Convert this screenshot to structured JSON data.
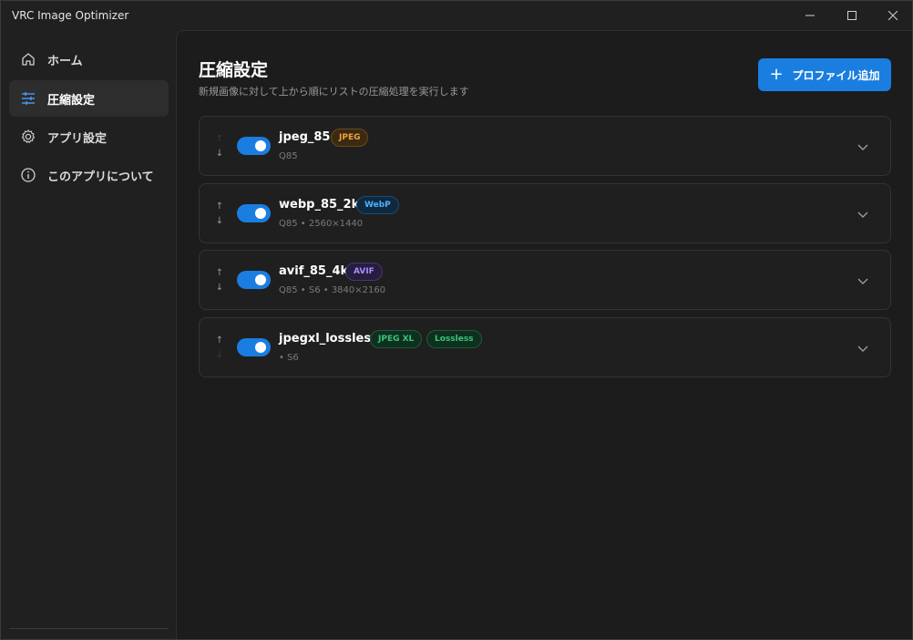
{
  "app": {
    "title": "VRC Image Optimizer"
  },
  "sidebar": {
    "items": [
      {
        "label": "ホーム",
        "icon": "home-icon"
      },
      {
        "label": "圧縮設定",
        "icon": "sliders-icon",
        "active": true
      },
      {
        "label": "アプリ設定",
        "icon": "gear-icon"
      },
      {
        "label": "このアプリについて",
        "icon": "info-icon"
      }
    ]
  },
  "main": {
    "title": "圧縮設定",
    "subtitle": "新規画像に対して上から順にリストの圧縮処理を実行します",
    "add_button_label": "プロファイル追加"
  },
  "profiles": [
    {
      "name": "jpeg_85",
      "badges": [
        "JPEG"
      ],
      "meta": "Q85",
      "enabled": true
    },
    {
      "name": "webp_85_2k",
      "badges": [
        "WebP"
      ],
      "meta": "Q85  • 2560×1440",
      "enabled": true
    },
    {
      "name": "avif_85_4k",
      "badges": [
        "AVIF"
      ],
      "meta": "Q85  • S6  • 3840×2160",
      "enabled": true
    },
    {
      "name": "jpegxl_lossless",
      "badges": [
        "JPEG XL",
        "Lossless"
      ],
      "meta": "• S6",
      "enabled": true
    }
  ],
  "colors": {
    "accent": "#1a7ee0",
    "background": "#1c1c1c",
    "jpeg_badge": "#f0a33a",
    "webp_badge": "#4db3ff",
    "avif_badge": "#a98bff",
    "jxl_badge": "#39c47a"
  }
}
